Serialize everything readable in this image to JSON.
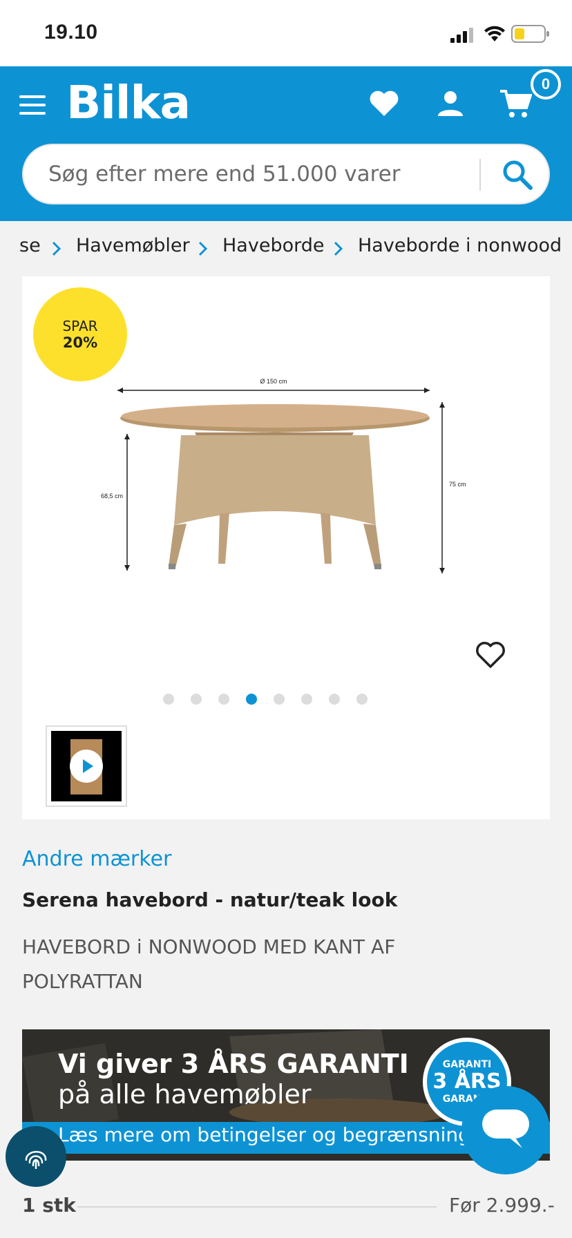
{
  "status_bar": {
    "time": "19.10"
  },
  "header": {
    "logo": "Bilka",
    "cart_count": "0",
    "search_placeholder": "Søg efter mere end 51.000 varer"
  },
  "breadcrumb": [
    "se",
    "Havemøbler",
    "Haveborde",
    "Haveborde i nonwood"
  ],
  "gallery": {
    "badge_label": "SPAR",
    "badge_value": "20%",
    "dimension_diameter": "Ø 150 cm",
    "dimension_height_left": "68,5 cm",
    "dimension_height_right": "75 cm",
    "dots_total": 8,
    "dots_active_index": 3
  },
  "product": {
    "brand": "Andre mærker",
    "title": "Serena havebord - natur/teak look",
    "subtitle": "HAVEBORD i NONWOOD MED KANT AF POLYRATTAN"
  },
  "banner": {
    "line1": "Vi giver 3 ÅRS GARANTI",
    "line2": "på alle havemøbler",
    "link": "Læs mere om betingelser og begrænsninger",
    "seal_top": "GARANTI",
    "seal_mid": "3 ÅRS",
    "seal_bottom": "GARANTI"
  },
  "purchase": {
    "quantity": "1 stk",
    "price_before": "Før 2.999.-"
  },
  "colors": {
    "brand_blue": "#0d93d4",
    "badge_yellow": "#fde02b"
  }
}
